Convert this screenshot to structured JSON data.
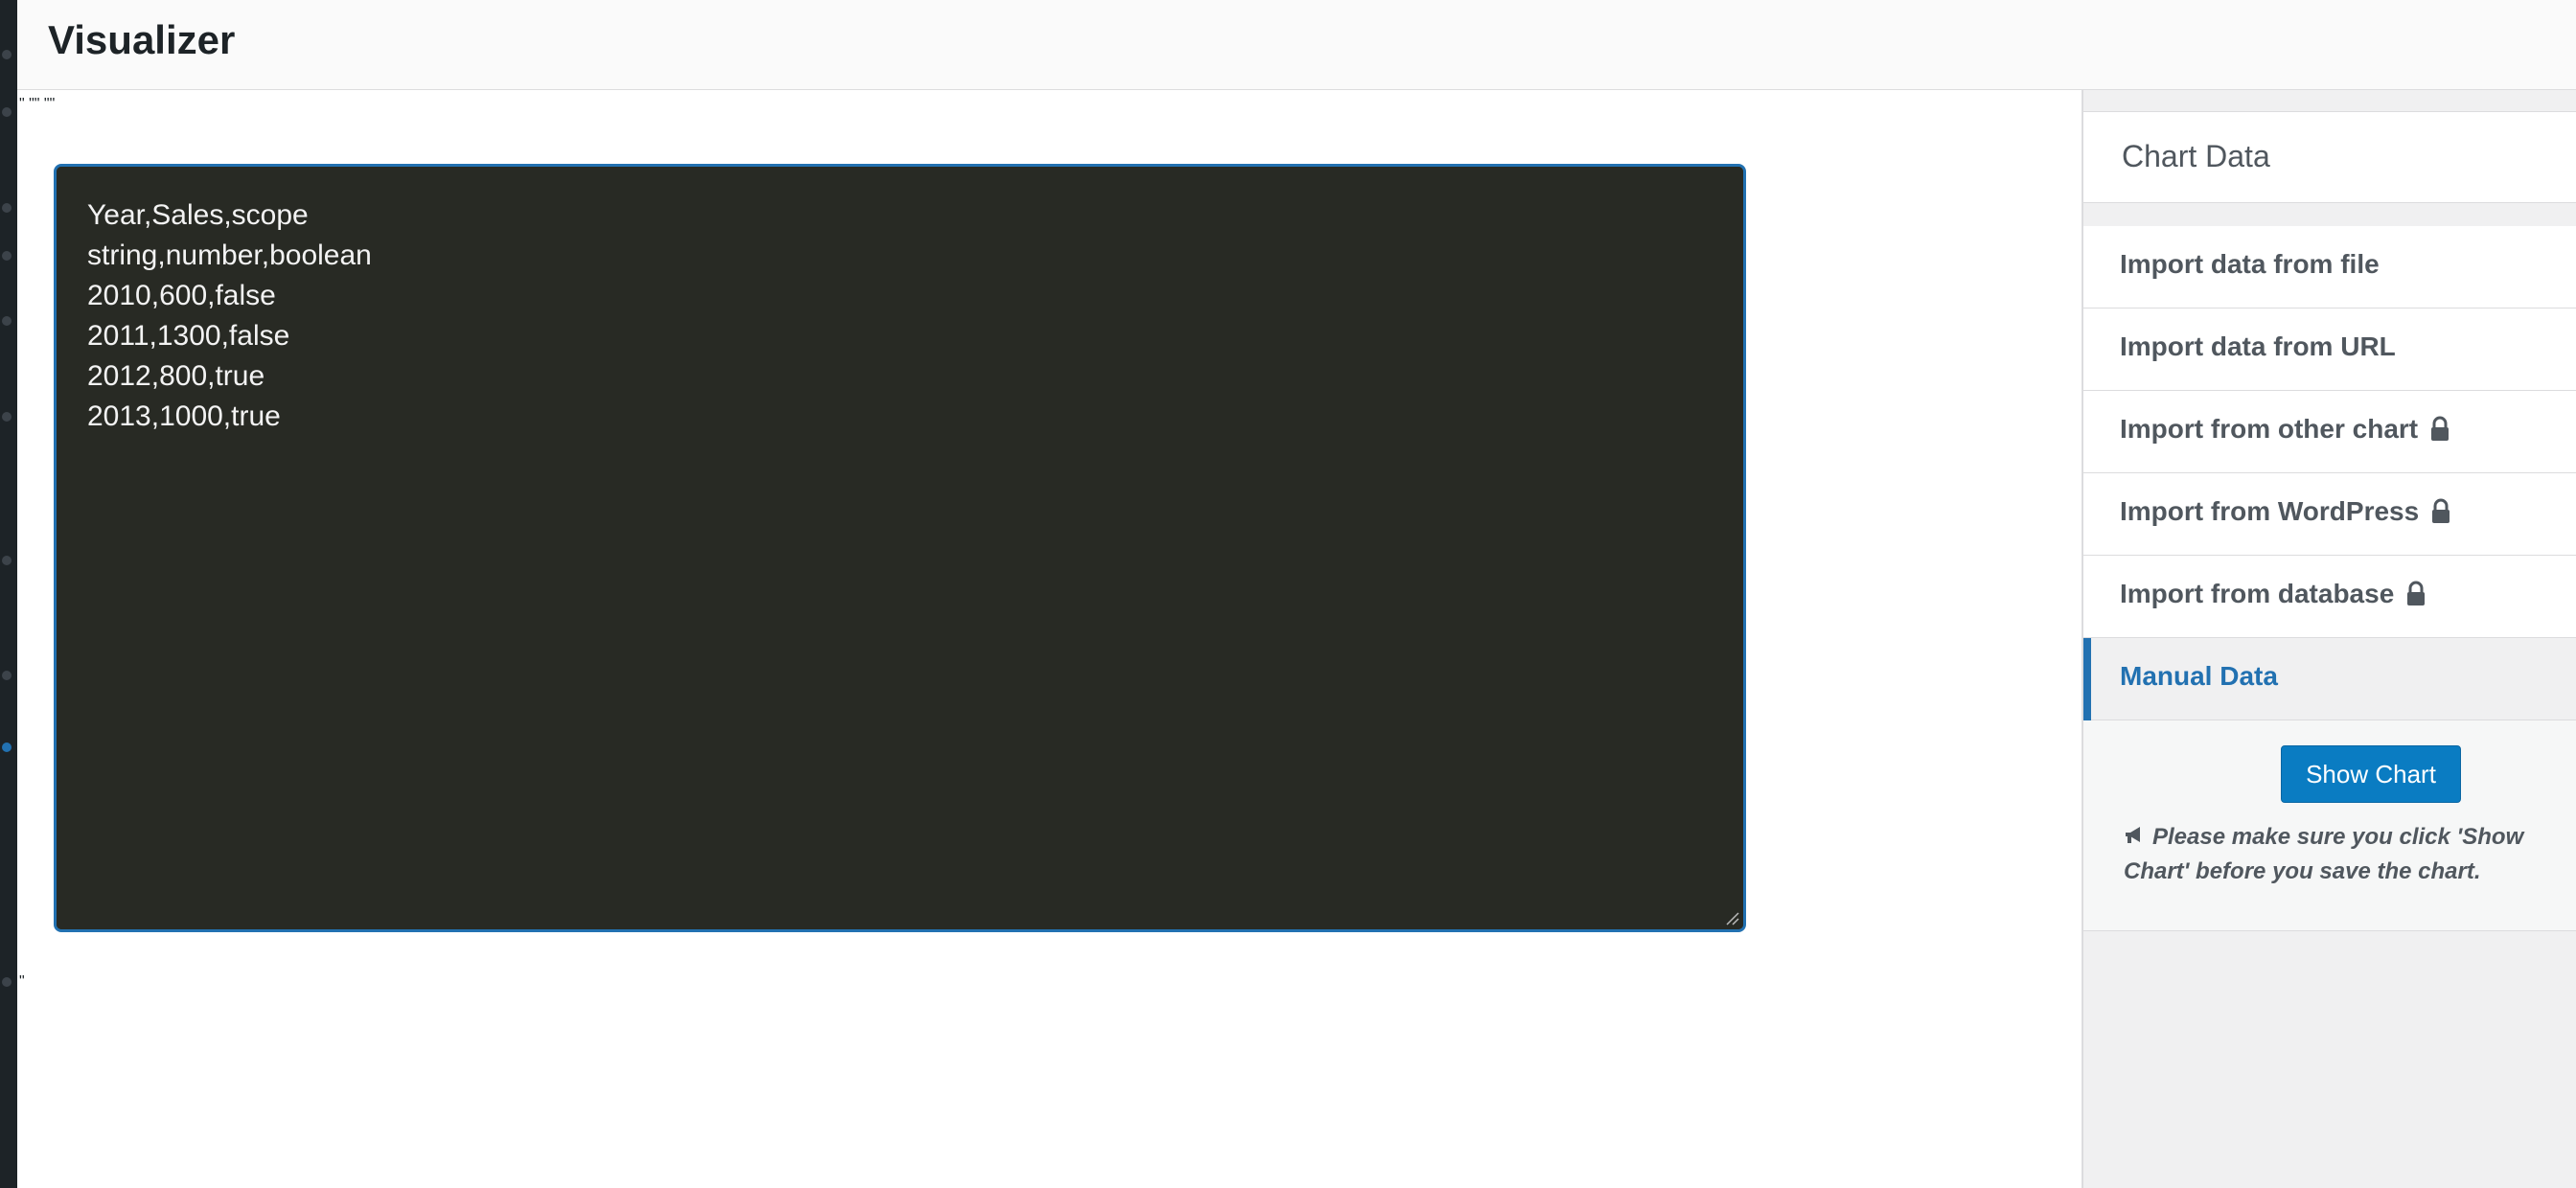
{
  "header": {
    "title": "Visualizer"
  },
  "stray": {
    "top": "\" \"\" \"\"",
    "bottom": "\""
  },
  "editor": {
    "content": "Year,Sales,scope\nstring,number,boolean\n2010,600,false\n2011,1300,false\n2012,800,true\n2013,1000,true"
  },
  "sidebar": {
    "title": "Chart Data",
    "items": [
      {
        "label": "Import data from file",
        "locked": false
      },
      {
        "label": "Import data from URL",
        "locked": false
      },
      {
        "label": "Import from other chart",
        "locked": true
      },
      {
        "label": "Import from WordPress",
        "locked": true
      },
      {
        "label": "Import from database",
        "locked": true
      },
      {
        "label": "Manual Data",
        "locked": false,
        "active": true
      }
    ],
    "show_chart_label": "Show Chart",
    "note": "Please make sure you click 'Show Chart' before you save the chart."
  },
  "colors": {
    "accent": "#2271b1",
    "button": "#0a7cc2",
    "editor_bg": "#282a24"
  }
}
